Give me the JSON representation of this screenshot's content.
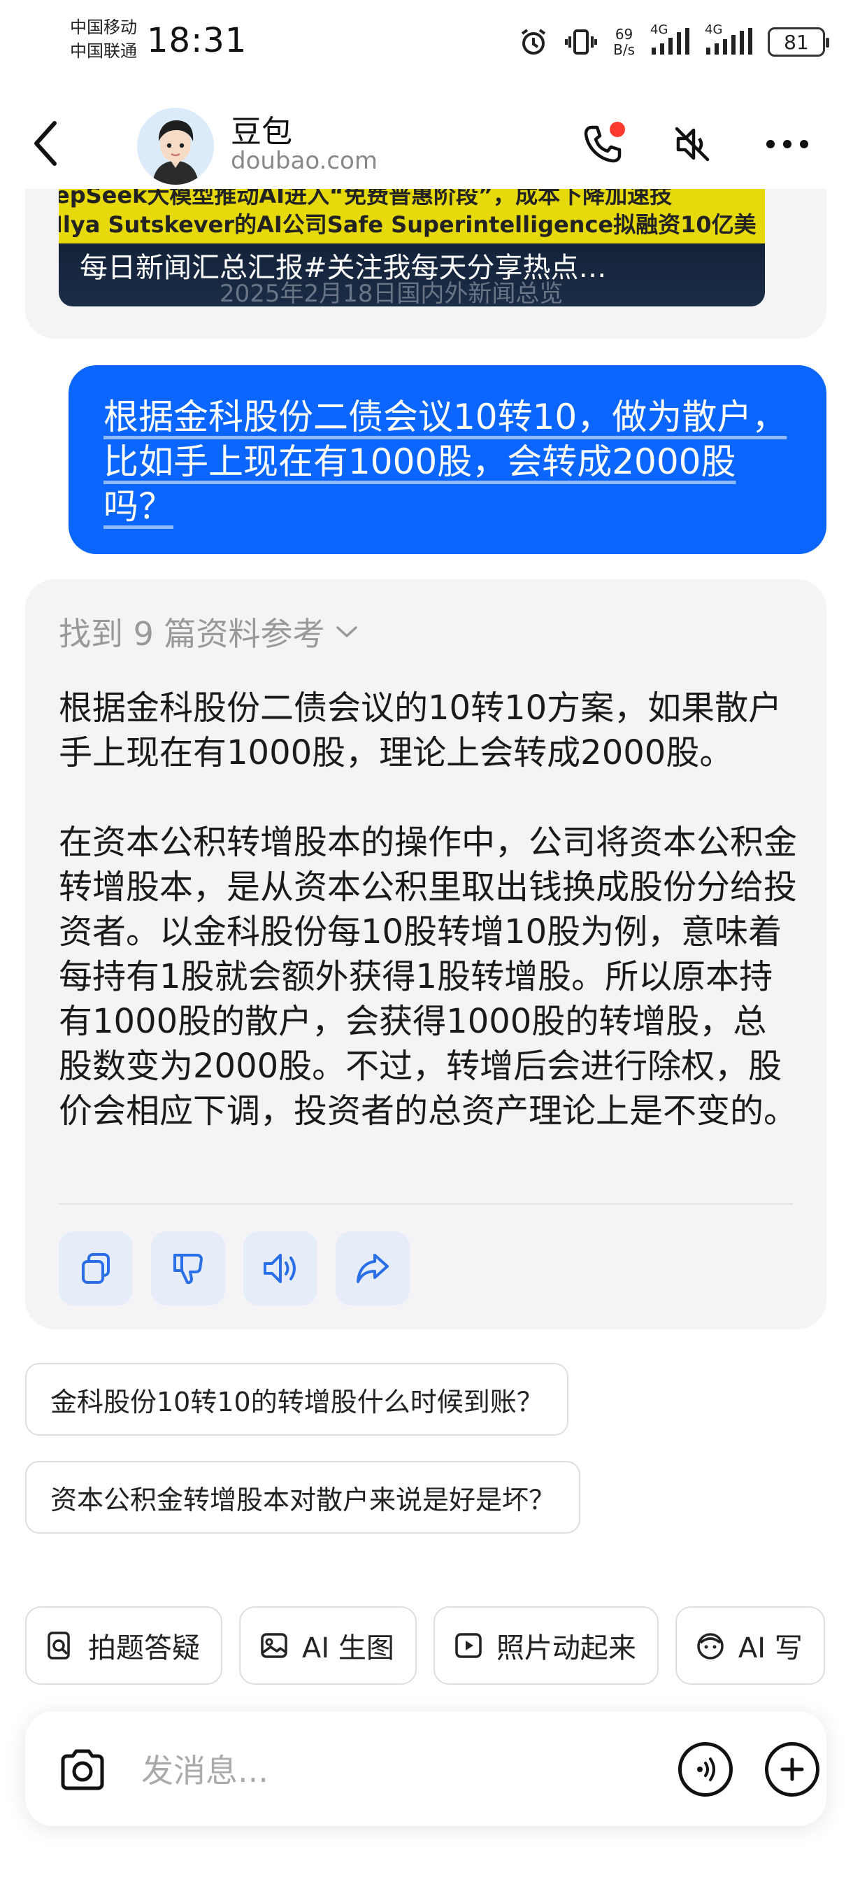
{
  "status_bar": {
    "carrier1": "中国移动",
    "carrier2": "中国联通",
    "time": "18:31",
    "net_speed_value": "69",
    "net_speed_unit": "B/s",
    "signal1": "4G",
    "signal2": "4G",
    "battery": "81"
  },
  "header": {
    "name": "豆包",
    "domain": "doubao.com"
  },
  "prev_card": {
    "line1": "epSeek大模型推动AI进入“免费普惠阶段”，成本下降加速技",
    "line2": "Ilya Sutskever的AI公司Safe Superintelligence拟融资10亿美",
    "title": "每日新闻汇总汇报#关注我每天分享热点…",
    "subtitle": "2025年2月18日国内外新闻总览"
  },
  "user_message": {
    "text": "根据金科股份二债会议10转10，做为散户，比如手上现在有1000股，会转成2000股吗？"
  },
  "answer": {
    "refs_label": "找到 9 篇资料参考",
    "paragraph1": "根据金科股份二债会议的10转10方案，如果散户手上现在有1000股，理论上会转成2000股。",
    "paragraph2": "在资本公积转增股本的操作中，公司将资本公积金转增股本，是从资本公积里取出钱换成股份分给投资者。以金科股份每10股转增10股为例，意味着每持有1股就会额外获得1股转增股。所以原本持有1000股的散户，会获得1000股的转增股，总股数变为2000股。不过，转增后会进行除权，股价会相应下调，投资者的总资产理论上是不变的。",
    "action_icons": [
      "copy-icon",
      "thumbs-down-icon",
      "speaker-icon",
      "share-icon"
    ]
  },
  "suggestions": [
    "金科股份10转10的转增股什么时候到账？",
    "资本公积金转增股本对散户来说是好是坏？"
  ],
  "tools": [
    {
      "icon": "photo-search-icon",
      "label": "拍题答疑"
    },
    {
      "icon": "image-icon",
      "label": "AI 生图"
    },
    {
      "icon": "play-icon",
      "label": "照片动起来"
    },
    {
      "icon": "face-icon",
      "label": "AI 写"
    }
  ],
  "input": {
    "placeholder": "发消息..."
  },
  "colors": {
    "accent": "#0a66ff",
    "card_bg": "#f4f4f6",
    "notification_dot": "#ff3b30"
  }
}
